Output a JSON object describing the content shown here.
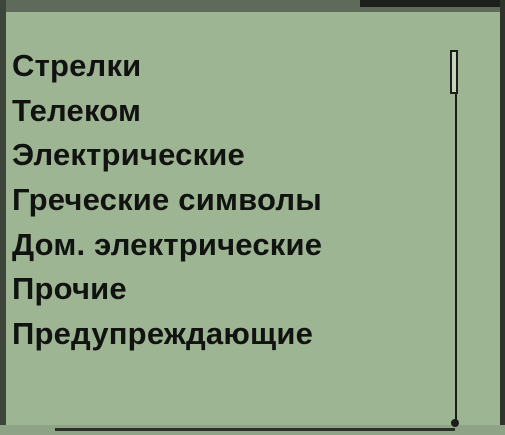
{
  "menu": {
    "items": [
      {
        "label": "Стрелки"
      },
      {
        "label": "Телеком"
      },
      {
        "label": "Электрические"
      },
      {
        "label": "Греческие символы"
      },
      {
        "label": "Дом. электрические"
      },
      {
        "label": "Прочие"
      },
      {
        "label": "Предупреждающие"
      }
    ]
  },
  "colors": {
    "lcd_background": "#9eb594",
    "text": "#111311",
    "bezel": "#5e6a5a"
  },
  "scrollbar": {
    "position_fraction": 0.0
  }
}
